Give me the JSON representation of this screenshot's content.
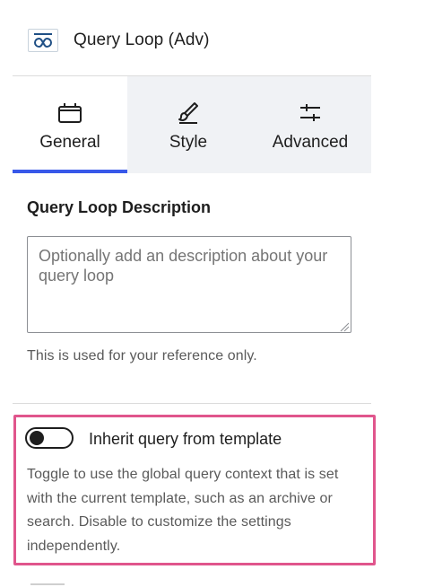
{
  "header": {
    "block_icon": "query-loop-icon",
    "title": "Query Loop (Adv)"
  },
  "tabs": [
    {
      "label": "General",
      "icon": "calendar-block-icon",
      "active": true
    },
    {
      "label": "Style",
      "icon": "brush-icon",
      "active": false
    },
    {
      "label": "Advanced",
      "icon": "sliders-icon",
      "active": false
    }
  ],
  "description": {
    "title": "Query Loop Description",
    "placeholder": "Optionally add an description about your query loop",
    "value": "",
    "help": "This is used for your reference only."
  },
  "inherit": {
    "label": "Inherit query from template",
    "enabled": false,
    "help": "Toggle to use the global query context that is set with the current template, such as an archive or search. Disable to customize the settings independently."
  },
  "colors": {
    "accent": "#3858e9",
    "highlight": "#e0558c",
    "tab_inactive_bg": "#f0f2f5"
  }
}
